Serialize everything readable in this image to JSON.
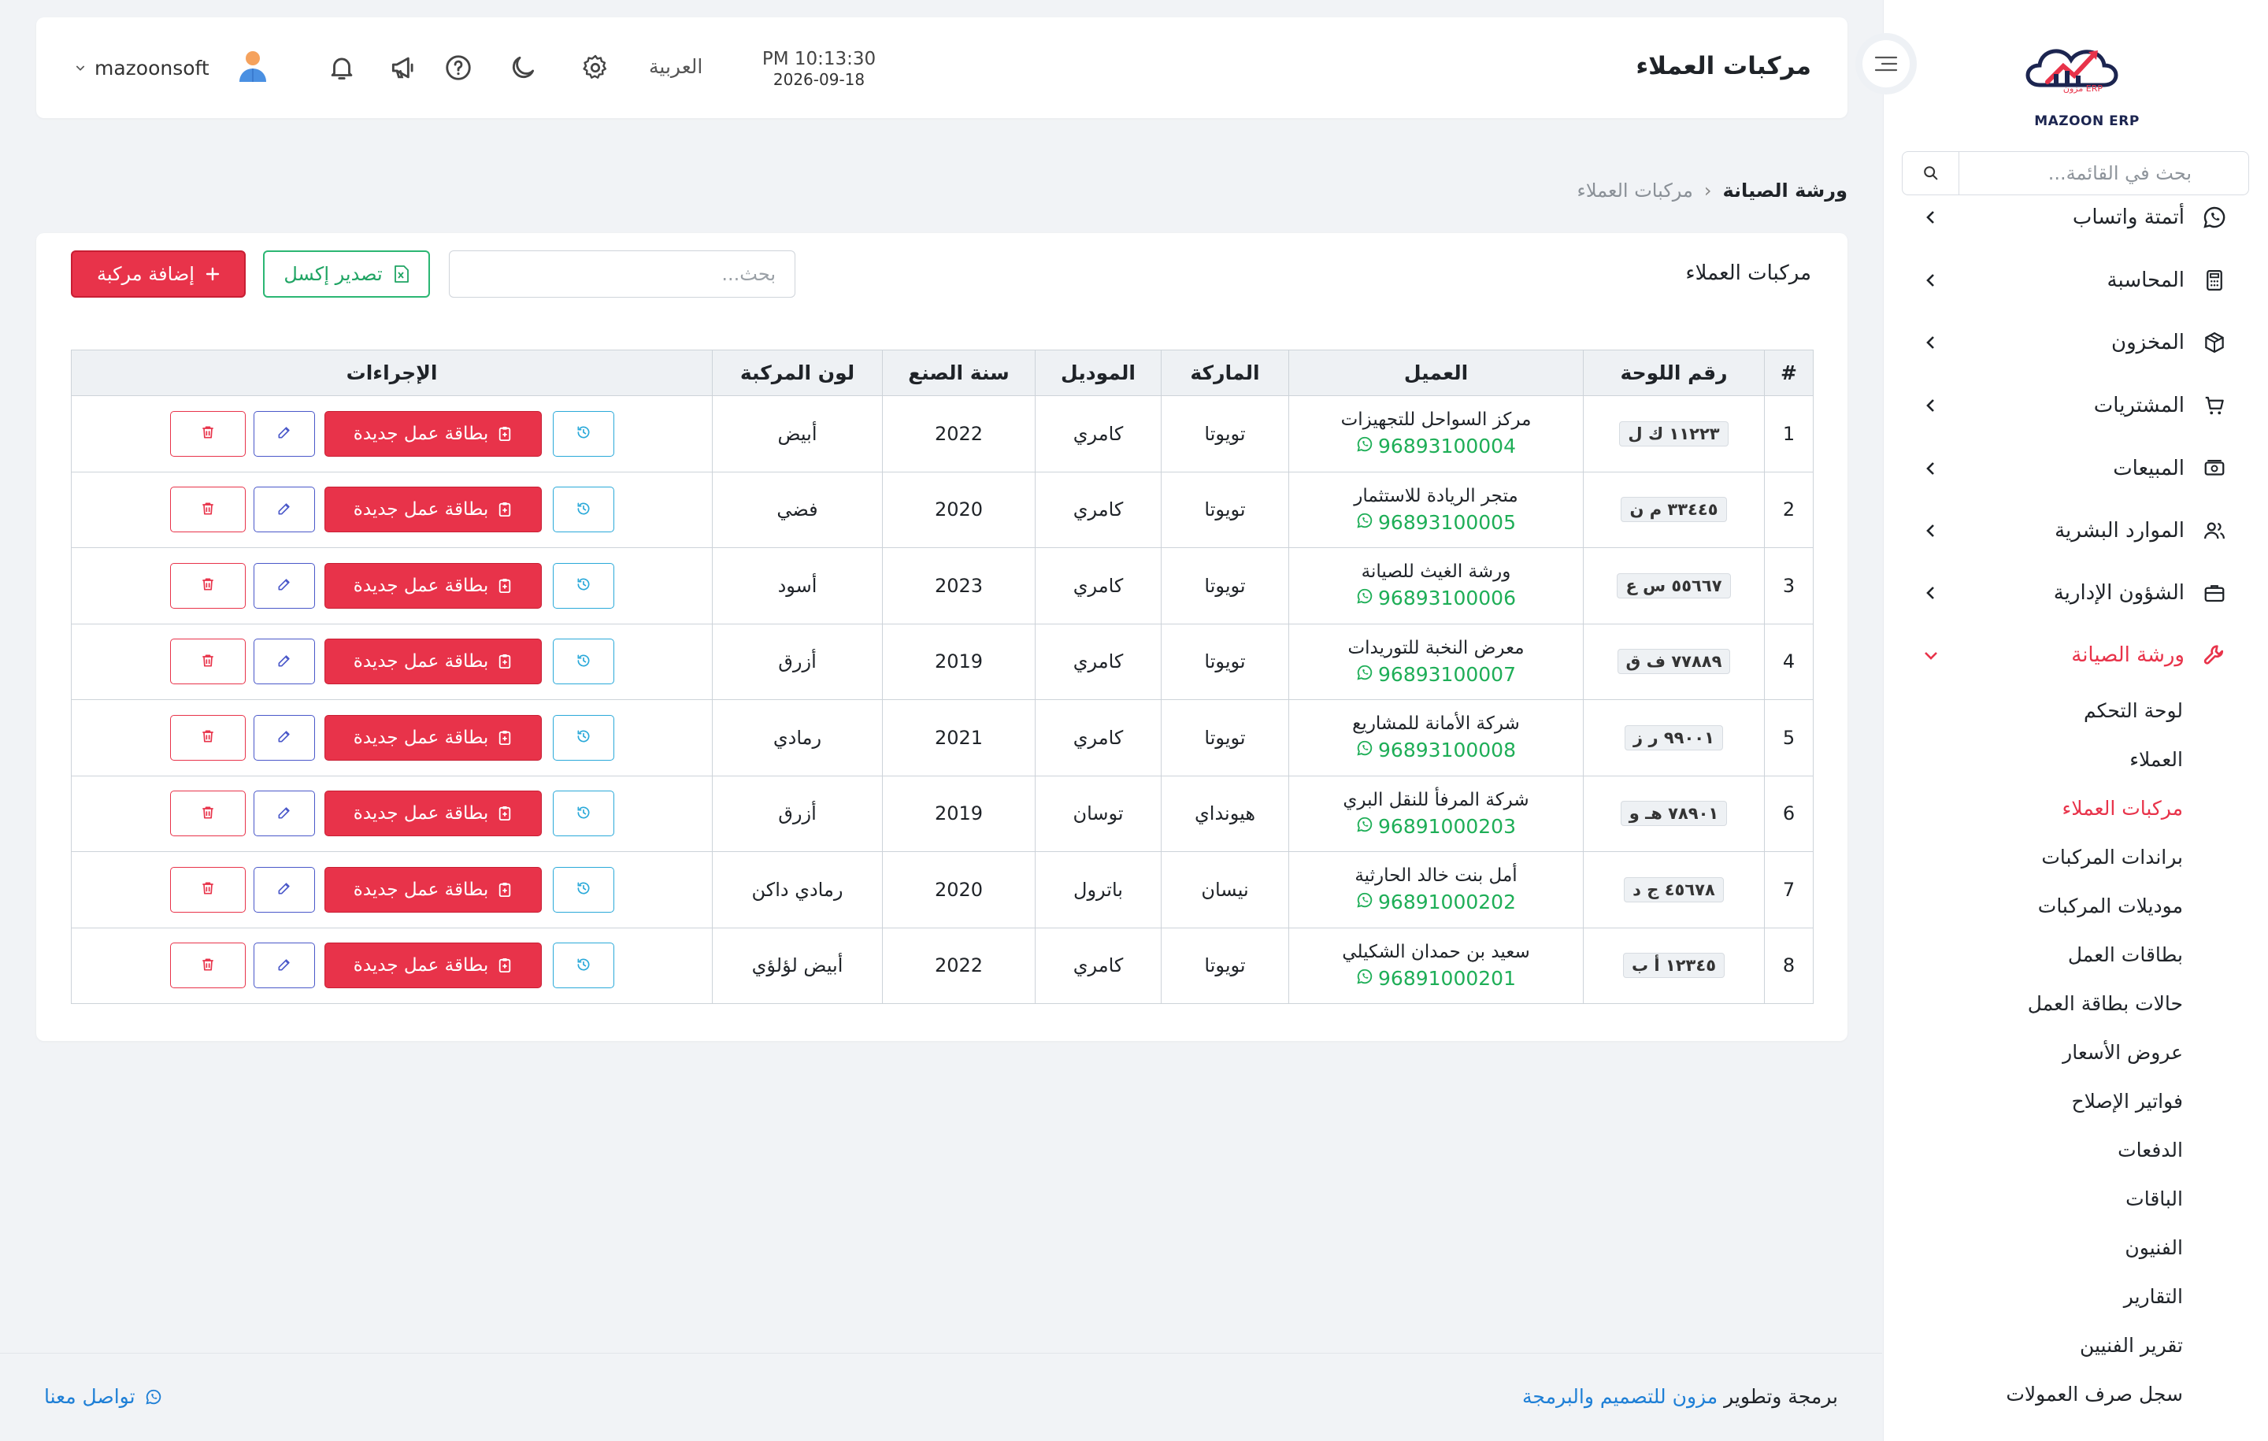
{
  "app": {
    "logo_text": "MAZOON ERP",
    "logo_small": "ERP مزون"
  },
  "colors": {
    "accent": "#e8334a",
    "success": "#1eae57",
    "link": "#1e7fd6",
    "info": "#2aa9d9",
    "edit": "#4a58c9"
  },
  "sidebar": {
    "search_placeholder": "بحث في القائمة...",
    "items": [
      {
        "label": "أتمتة واتساب",
        "icon": "whatsapp-icon"
      },
      {
        "label": "المحاسبة",
        "icon": "calculator-icon"
      },
      {
        "label": "المخزون",
        "icon": "box-icon"
      },
      {
        "label": "المشتريات",
        "icon": "cart-icon"
      },
      {
        "label": "المبيعات",
        "icon": "cash-icon"
      },
      {
        "label": "الموارد البشرية",
        "icon": "users-icon"
      },
      {
        "label": "الشؤون الإدارية",
        "icon": "briefcase-icon"
      },
      {
        "label": "ورشة الصيانة",
        "icon": "wrench-icon"
      }
    ],
    "subitems": [
      {
        "label": "لوحة التحكم"
      },
      {
        "label": "العملاء"
      },
      {
        "label": "مركبات العملاء"
      },
      {
        "label": "براندات المركبات"
      },
      {
        "label": "موديلات المركبات"
      },
      {
        "label": "بطاقات العمل"
      },
      {
        "label": "حالات بطاقة العمل"
      },
      {
        "label": "عروض الأسعار"
      },
      {
        "label": "فواتير الإصلاح"
      },
      {
        "label": "الدفعات"
      },
      {
        "label": "الباقات"
      },
      {
        "label": "الفنيون"
      },
      {
        "label": "التقارير"
      },
      {
        "label": "تقرير الفنيين"
      },
      {
        "label": "سجل صرف العمولات"
      }
    ]
  },
  "header": {
    "title": "مركبات العملاء",
    "time": "PM 10:13:30",
    "date": "2026-09-18",
    "language": "العربية",
    "username": "mazoonsoft"
  },
  "breadcrumb": {
    "parent": "ورشة الصيانة",
    "separator": "›",
    "current": "مركبات العملاء"
  },
  "card": {
    "title": "مركبات العملاء",
    "search_placeholder": "بحث...",
    "export_label": "تصدير إكسل",
    "add_label": "إضافة مركبة"
  },
  "table": {
    "columns": [
      "#",
      "رقم اللوحة",
      "العميل",
      "الماركة",
      "الموديل",
      "سنة الصنع",
      "لون المركبة",
      "الإجراءات"
    ],
    "job_card_label": "بطاقة عمل جديدة",
    "rows": [
      {
        "n": "1",
        "plate": "١١٢٢٣ ك ل",
        "customer": "مركز السواحل للتجهيزات",
        "phone": "96893100004",
        "brand": "تويوتا",
        "model": "كامري",
        "year": "2022",
        "color": "أبيض"
      },
      {
        "n": "2",
        "plate": "٣٣٤٤٥ م ن",
        "customer": "متجر الريادة للاستثمار",
        "phone": "96893100005",
        "brand": "تويوتا",
        "model": "كامري",
        "year": "2020",
        "color": "فضي"
      },
      {
        "n": "3",
        "plate": "٥٥٦٦٧ س ع",
        "customer": "ورشة الغيث للصيانة",
        "phone": "96893100006",
        "brand": "تويوتا",
        "model": "كامري",
        "year": "2023",
        "color": "أسود"
      },
      {
        "n": "4",
        "plate": "٧٧٨٨٩ ف ق",
        "customer": "معرض النخبة للتوريدات",
        "phone": "96893100007",
        "brand": "تويوتا",
        "model": "كامري",
        "year": "2019",
        "color": "أزرق"
      },
      {
        "n": "5",
        "plate": "٩٩٠٠١ ر ز",
        "customer": "شركة الأمانة للمشاريع",
        "phone": "96893100008",
        "brand": "تويوتا",
        "model": "كامري",
        "year": "2021",
        "color": "رمادي"
      },
      {
        "n": "6",
        "plate": "٧٨٩٠١ هـ و",
        "customer": "شركة المرفأ للنقل البري",
        "phone": "96891000203",
        "brand": "هيونداي",
        "model": "توسان",
        "year": "2019",
        "color": "أزرق"
      },
      {
        "n": "7",
        "plate": "٤٥٦٧٨ ج د",
        "customer": "أمل بنت خالد الحارثية",
        "phone": "96891000202",
        "brand": "نيسان",
        "model": "باترول",
        "year": "2020",
        "color": "رمادي داكن"
      },
      {
        "n": "8",
        "plate": "١٢٣٤٥ أ ب",
        "customer": "سعيد بن حمدان الشكيلي",
        "phone": "96891000201",
        "brand": "تويوتا",
        "model": "كامري",
        "year": "2022",
        "color": "أبيض لؤلؤي"
      }
    ]
  },
  "footer": {
    "credit_prefix": "برمجة وتطوير",
    "credit_link": "مزون للتصميم والبرمجة",
    "contact": "تواصل معنا"
  }
}
